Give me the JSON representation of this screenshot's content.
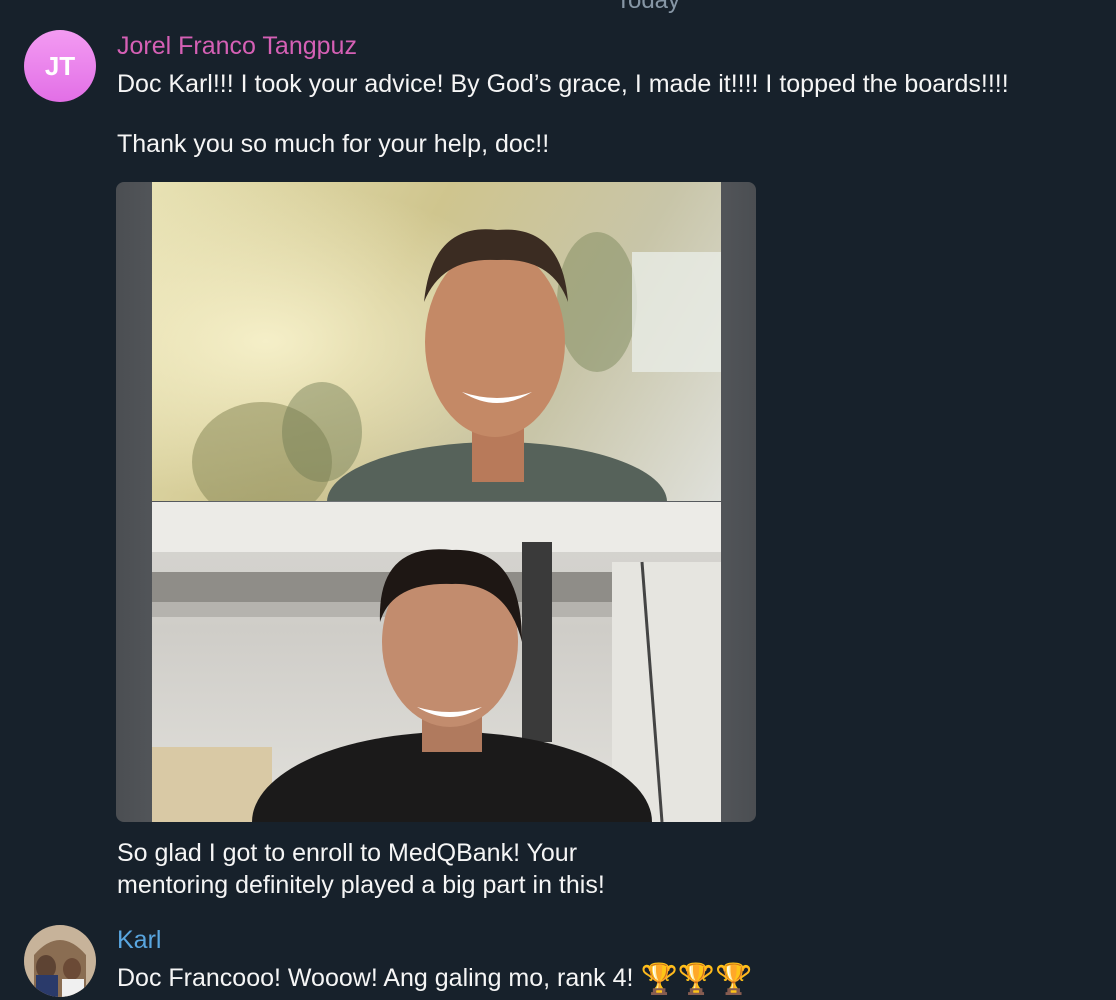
{
  "date_separator": "Today",
  "messages": [
    {
      "sender": "Jorel Franco Tangpuz",
      "avatar_initials": "JT",
      "avatar_color": "#ea7ee8",
      "name_color": "#d560b5",
      "lines": [
        "Doc Karl!!! I took your advice! By God’s grace, I made it!!!! I topped the boards!!!!",
        "Thank you so much for your help, doc!!"
      ],
      "caption_lines": [
        "So glad I got to enroll to MedQBank! Your",
        "mentoring definitely played a big part in this!"
      ],
      "media": {
        "type": "photo",
        "panels": [
          "video-call-top",
          "video-call-bottom"
        ]
      }
    },
    {
      "sender": "Karl",
      "name_color": "#59a6e0",
      "avatar": "photo",
      "text": "Doc Francooo! Wooow! Ang galing mo, rank 4!",
      "emoji": "🏆🏆🏆"
    }
  ]
}
